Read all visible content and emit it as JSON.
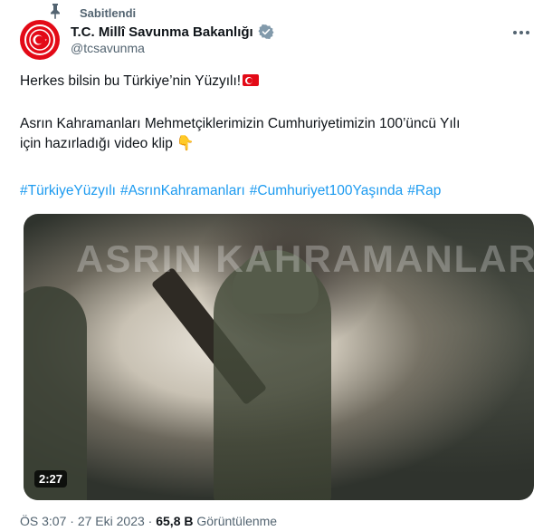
{
  "pinned_label": "Sabitlendi",
  "account": {
    "name": "T.C. Millî Savunma Bakanlığı",
    "handle": "@tcsavunma"
  },
  "tweet": {
    "line1": "Herkes bilsin bu Türkiye’nin Yüzyılı!",
    "line2": "Asrın Kahramanları Mehmetçiklerimizin Cumhuriyetimizin 100’üncü Yılı",
    "line3": "için hazırladığı video klip",
    "hashtags": [
      "#TürkiyeYüzyılı",
      "#AsrınKahramanları",
      "#Cumhuriyet100Yaşında",
      "#Rap"
    ]
  },
  "media": {
    "watermark": "ASRIN KAHRAMANLARI",
    "duration": "2:27"
  },
  "meta": {
    "time": "ÖS 3:07",
    "date": "27 Eki 2023",
    "views": "65,8 B",
    "views_label": "Görüntülenme",
    "separator": "·"
  },
  "colors": {
    "accent": "#1d9bf0",
    "secondary_text": "#536471",
    "flag_red": "#e30a17"
  },
  "icons": [
    "pin-icon",
    "verified-badge-icon",
    "more-options-icon",
    "turkish-flag-emoji",
    "pointing-down-emoji"
  ]
}
